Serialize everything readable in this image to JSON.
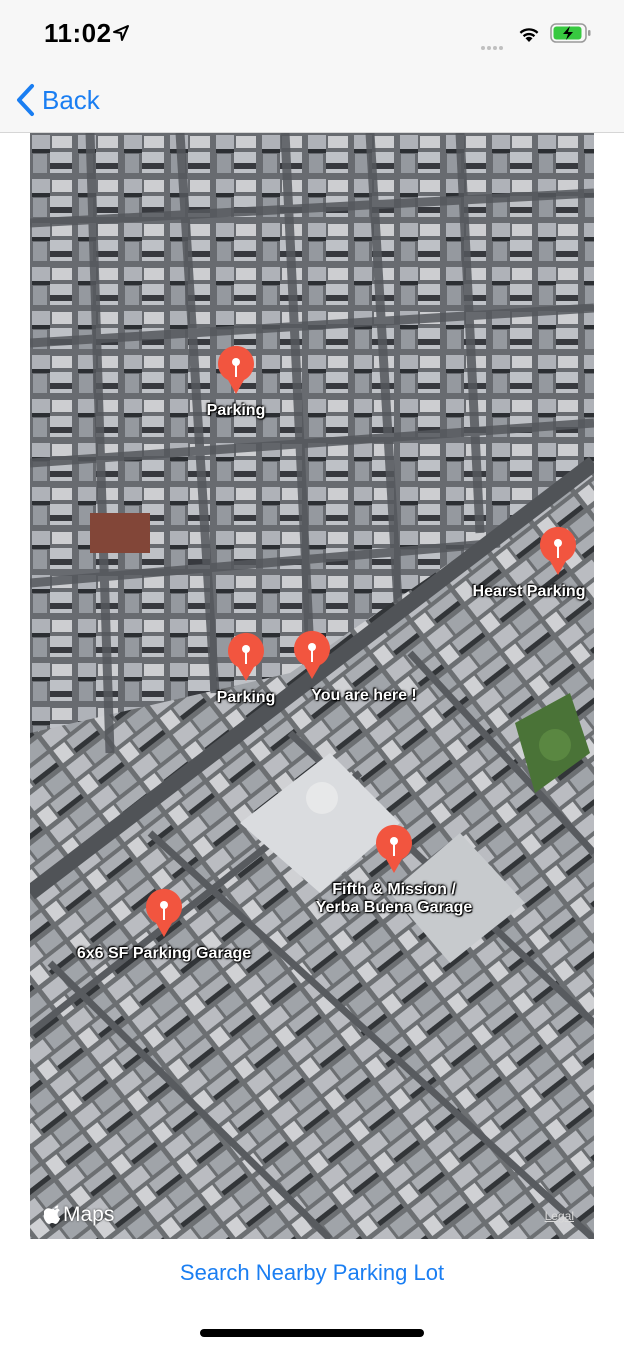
{
  "status_bar": {
    "time": "11:02",
    "battery_color": "#37c940"
  },
  "nav": {
    "back_label": "Back"
  },
  "map": {
    "attribution": "Maps",
    "legal": "Legal",
    "pin_color": "#f2553f",
    "annotations": [
      {
        "title": "Parking"
      },
      {
        "title": "Hearst Parking"
      },
      {
        "title": "Parking"
      },
      {
        "title": "You are here !"
      },
      {
        "title": "Fifth & Mission /\nYerba Buena Garage"
      },
      {
        "title": "6x6 SF Parking Garage"
      }
    ]
  },
  "search_button": {
    "label": "Search Nearby Parking Lot"
  },
  "accent_color": "#1a7ef2"
}
